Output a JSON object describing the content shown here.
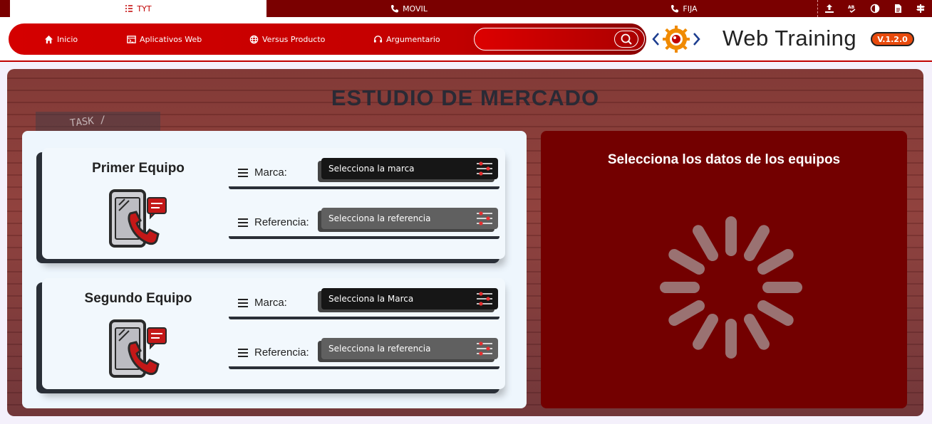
{
  "tabs": [
    {
      "label": "TYT",
      "active": true,
      "icon": "list-check-icon"
    },
    {
      "label": "MOVIL",
      "active": false,
      "icon": "phone-icon"
    },
    {
      "label": "FIJA",
      "active": false,
      "icon": "phone-icon"
    }
  ],
  "toolbar": {
    "icons": [
      "upload-icon",
      "spellcheck-icon",
      "contrast-icon",
      "document-icon",
      "signpost-icon"
    ]
  },
  "nav": {
    "items": [
      {
        "label": "Inicio",
        "icon": "home-icon"
      },
      {
        "label": "Aplicativos Web",
        "icon": "window-icon"
      },
      {
        "label": "Versus Producto",
        "icon": "globe-icon"
      },
      {
        "label": "Argumentario",
        "icon": "headset-icon"
      }
    ],
    "search_value": ""
  },
  "brand": {
    "title": "Web Training",
    "version": "V.1.2.0"
  },
  "main": {
    "background_text": "TASK /",
    "title": "ESTUDIO DE MERCADO",
    "equipos": [
      {
        "title": "Primer Equipo",
        "marca_label": "Marca:",
        "marca_value": "Selecciona la marca",
        "referencia_label": "Referencia:",
        "referencia_value": "Selecciona la referencia"
      },
      {
        "title": "Segundo Equipo",
        "marca_label": "Marca:",
        "marca_value": "Selecciona la Marca",
        "referencia_label": "Referencia:",
        "referencia_value": "Selecciona la referencia"
      }
    ],
    "result_title": "Selecciona los datos de los equipos"
  },
  "colors": {
    "primary_red": "#c00000",
    "dark_red": "#730000",
    "panel_light": "#eef6fd",
    "version_badge": "#e84a0c"
  }
}
